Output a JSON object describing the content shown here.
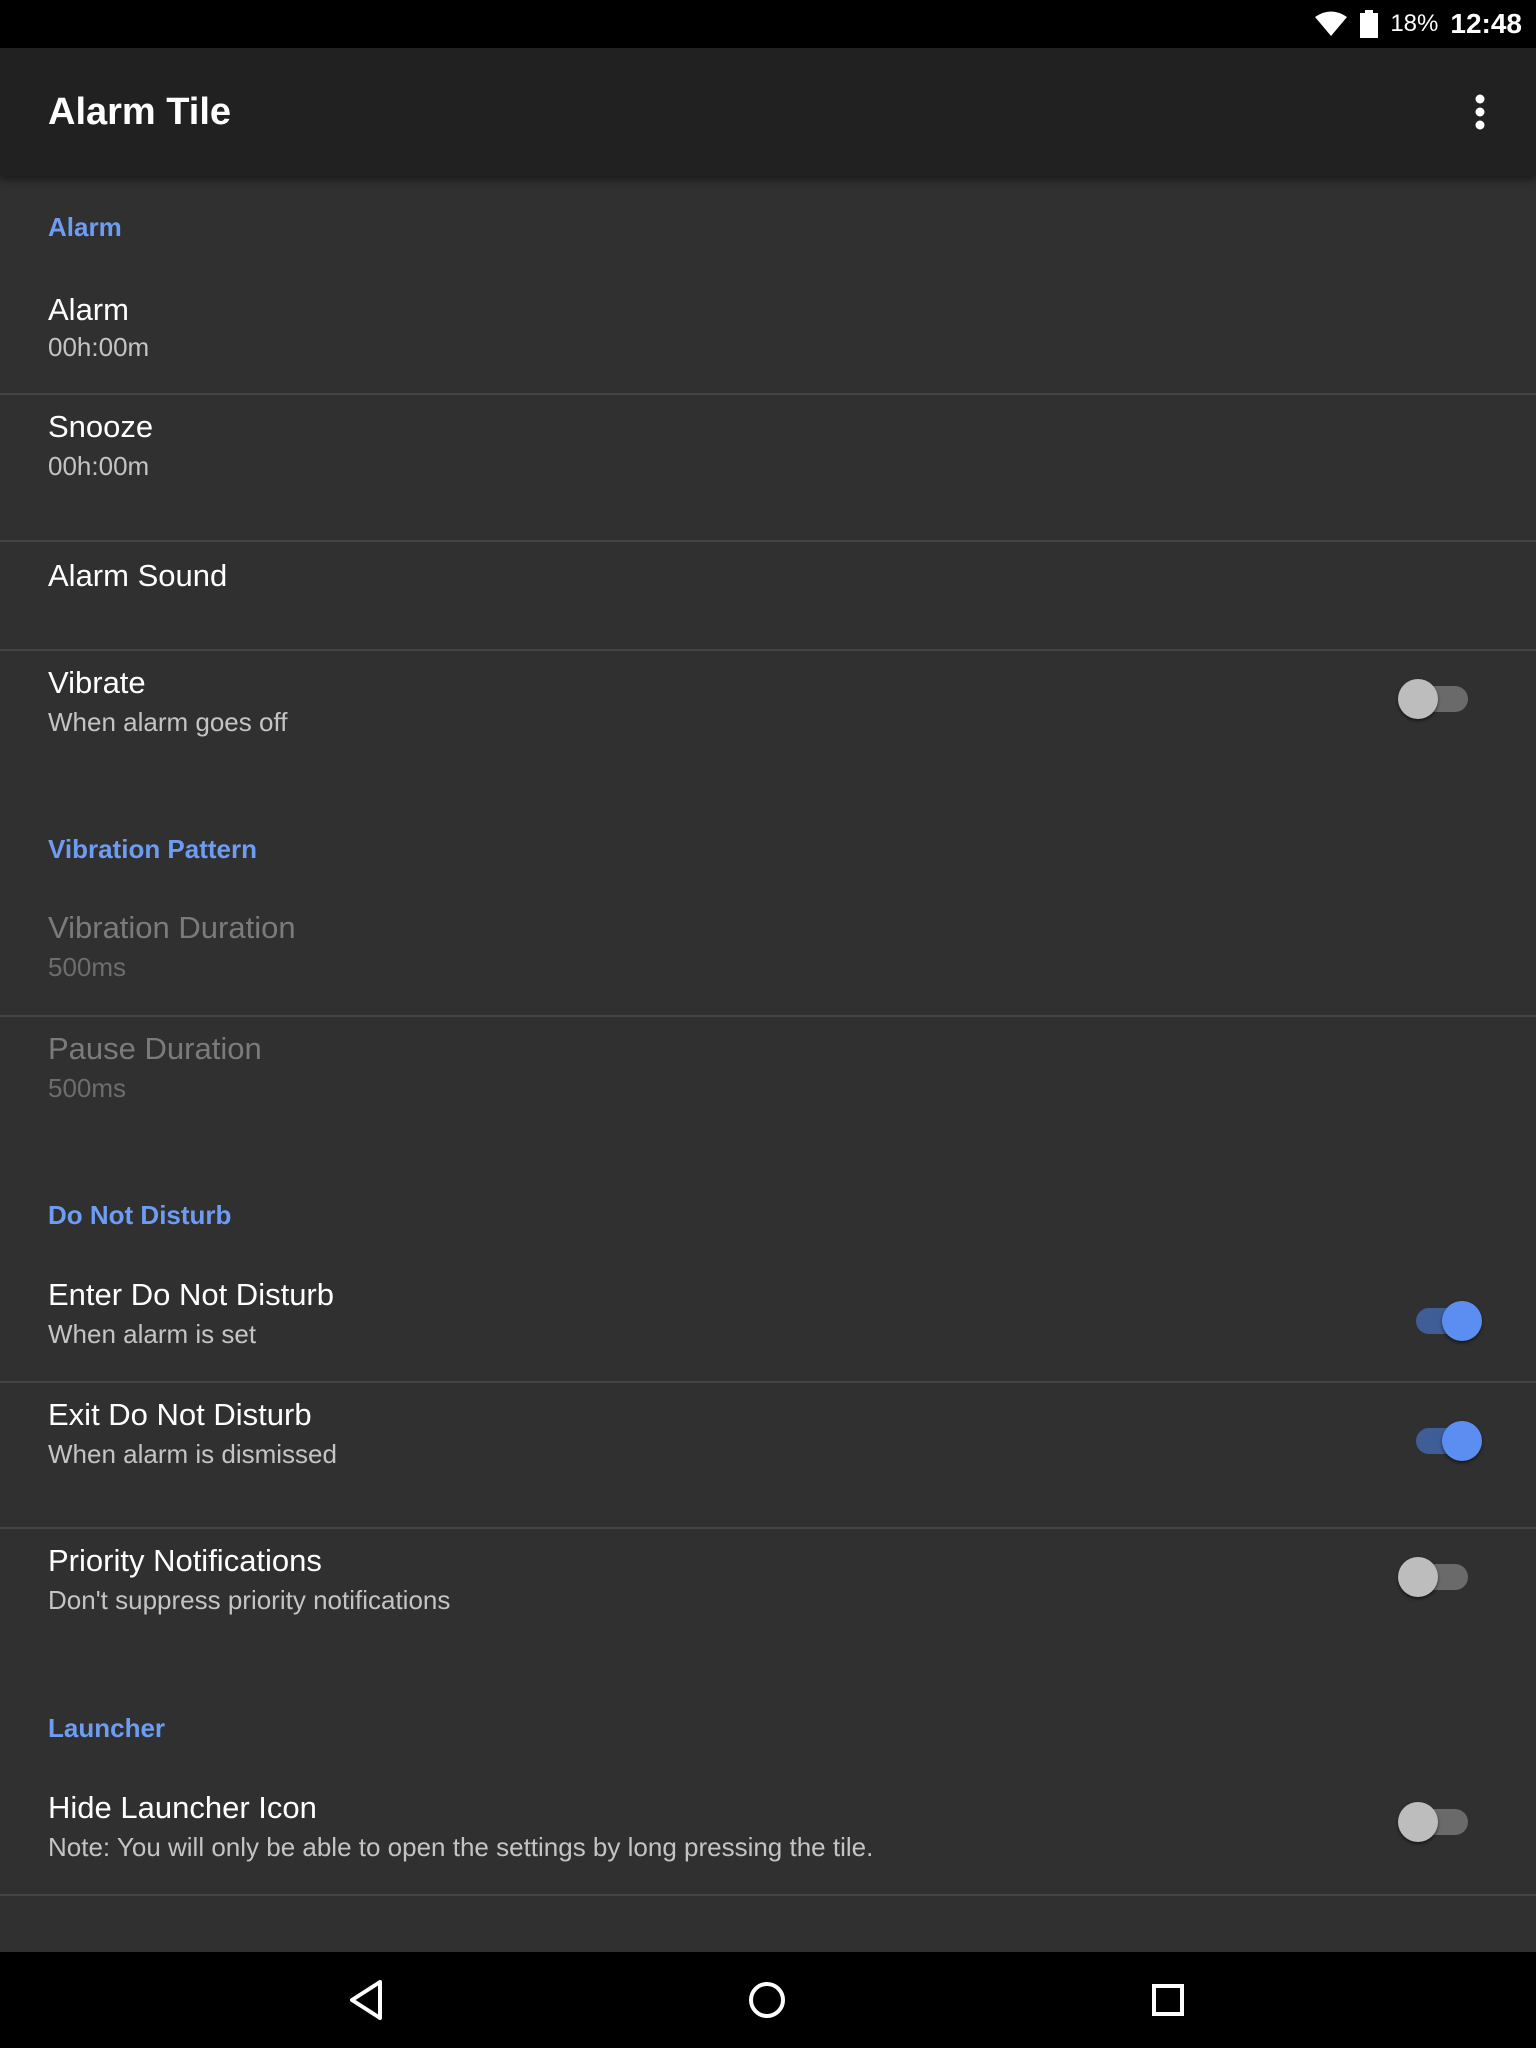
{
  "status_bar": {
    "battery_percent": "18%",
    "time": "12:48",
    "icons": [
      "wifi-icon",
      "battery-icon"
    ]
  },
  "app_bar": {
    "title": "Alarm Tile",
    "overflow_icon": "more-vert-icon"
  },
  "sections": {
    "alarm": {
      "header": "Alarm",
      "items": {
        "alarm": {
          "title": "Alarm",
          "summary": "00h:00m"
        },
        "snooze": {
          "title": "Snooze",
          "summary": "00h:00m"
        },
        "alarm_sound": {
          "title": "Alarm Sound"
        },
        "vibrate": {
          "title": "Vibrate",
          "summary": "When alarm goes off",
          "enabled": false
        }
      }
    },
    "vibration_pattern": {
      "header": "Vibration Pattern",
      "items": {
        "vibration_duration": {
          "title": "Vibration Duration",
          "summary": "500ms",
          "disabled": true
        },
        "pause_duration": {
          "title": "Pause Duration",
          "summary": "500ms",
          "disabled": true
        }
      }
    },
    "do_not_disturb": {
      "header": "Do Not Disturb",
      "items": {
        "enter_dnd": {
          "title": "Enter Do Not Disturb",
          "summary": "When alarm is set",
          "enabled": true
        },
        "exit_dnd": {
          "title": "Exit Do Not Disturb",
          "summary": "When alarm is dismissed",
          "enabled": true
        },
        "priority_notifications": {
          "title": "Priority Notifications",
          "summary": "Don't suppress priority notifications",
          "enabled": false
        }
      }
    },
    "launcher": {
      "header": "Launcher",
      "items": {
        "hide_launcher_icon": {
          "title": "Hide Launcher Icon",
          "summary": "Note: You will only be able to open the settings by long pressing the tile.",
          "enabled": false
        }
      }
    }
  },
  "nav_bar": {
    "icons": [
      "back-icon",
      "home-icon",
      "recents-icon"
    ]
  },
  "colors": {
    "accent": "#6e9cf2",
    "switch_on_thumb": "#5b8ef0",
    "background": "#303030",
    "app_bar": "#212121"
  }
}
